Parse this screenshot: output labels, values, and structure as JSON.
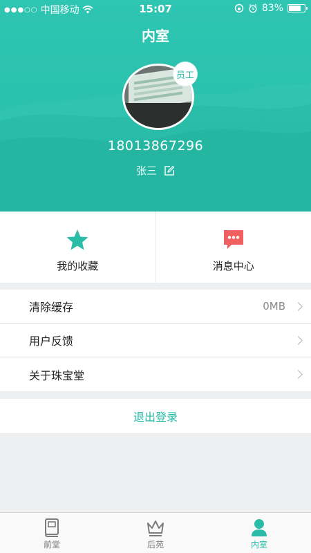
{
  "status_bar": {
    "carrier": "中国移动",
    "time": "15:07",
    "battery": "83%",
    "battery_level": 0.83
  },
  "header": {
    "title": "内室",
    "badge": "员工",
    "phone": "18013867296",
    "name": "张三"
  },
  "quick_actions": [
    {
      "label": "我的收藏",
      "icon": "star-icon",
      "color": "#2bbca8"
    },
    {
      "label": "消息中心",
      "icon": "message-icon",
      "color": "#f06060"
    }
  ],
  "settings": [
    {
      "label": "清除缓存",
      "value": "0MB"
    },
    {
      "label": "用户反馈",
      "value": ""
    },
    {
      "label": "关于珠宝堂",
      "value": ""
    }
  ],
  "logout_label": "退出登录",
  "tabs": [
    {
      "label": "前堂",
      "icon": "book-icon",
      "active": false
    },
    {
      "label": "后苑",
      "icon": "crown-icon",
      "active": false
    },
    {
      "label": "内室",
      "icon": "person-icon",
      "active": true
    }
  ],
  "colors": {
    "accent": "#2bbca8",
    "message": "#f06060"
  }
}
